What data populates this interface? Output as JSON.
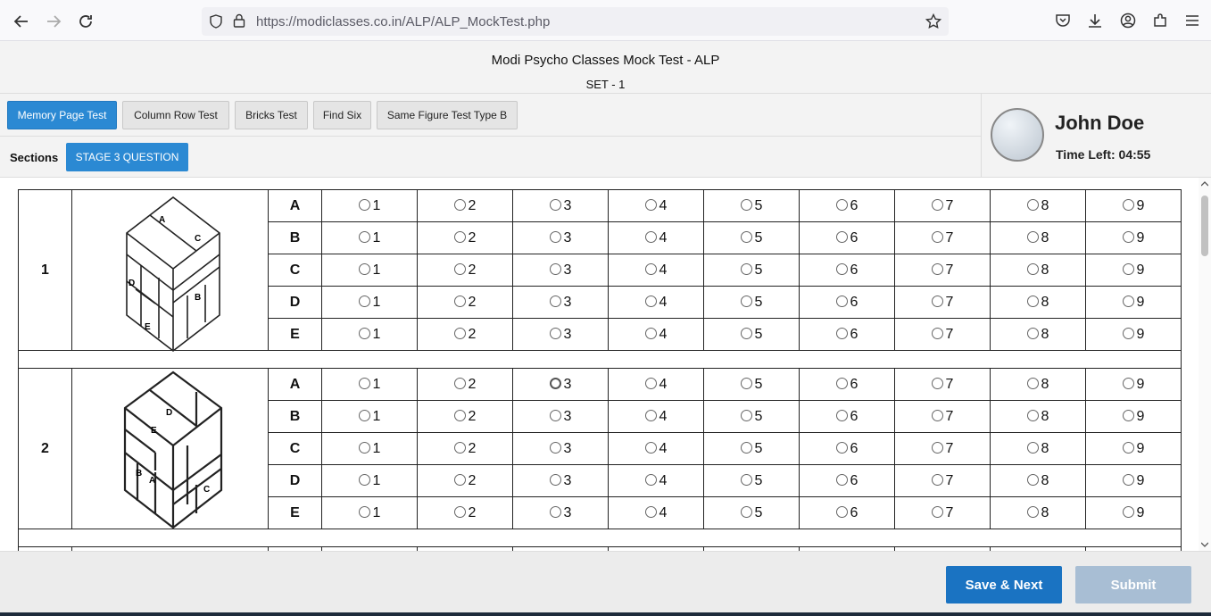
{
  "browser": {
    "url": "https://modiclasses.co.in/ALP/ALP_MockTest.php",
    "icons": [
      "back-icon",
      "forward-icon",
      "reload-icon",
      "shield-icon",
      "lock-icon",
      "star-icon",
      "pocket-icon",
      "download-icon",
      "account-icon",
      "extensions-icon",
      "menu-icon"
    ]
  },
  "header": {
    "title": "Modi Psycho Classes Mock Test - ALP",
    "set": "SET - 1"
  },
  "tabs": [
    {
      "label": "Memory Page Test",
      "active": true
    },
    {
      "label": "Column Row Test",
      "active": false
    },
    {
      "label": "Bricks Test",
      "active": false
    },
    {
      "label": "Find Six",
      "active": false
    },
    {
      "label": "Same Figure Test Type B",
      "active": false
    }
  ],
  "sections": {
    "label": "Sections",
    "stage_button": "STAGE 3 QUESTION"
  },
  "profile": {
    "name": "John Doe",
    "time_left": "Time Left: 04:55"
  },
  "questions": [
    {
      "number": "1",
      "figure_labels": [
        "A",
        "C",
        "D",
        "B",
        "E"
      ],
      "rows": [
        "A",
        "B",
        "C",
        "D",
        "E"
      ]
    },
    {
      "number": "2",
      "figure_labels": [
        "D",
        "E",
        "B",
        "A",
        "C"
      ],
      "rows": [
        "A",
        "B",
        "C",
        "D",
        "E"
      ]
    }
  ],
  "options": [
    "1",
    "2",
    "3",
    "4",
    "5",
    "6",
    "7",
    "8",
    "9"
  ],
  "footer": {
    "save_next": "Save & Next",
    "submit": "Submit"
  },
  "colors": {
    "accent": "#2b89d3",
    "save": "#1a73c2",
    "submit_disabled": "#a8bed4"
  }
}
